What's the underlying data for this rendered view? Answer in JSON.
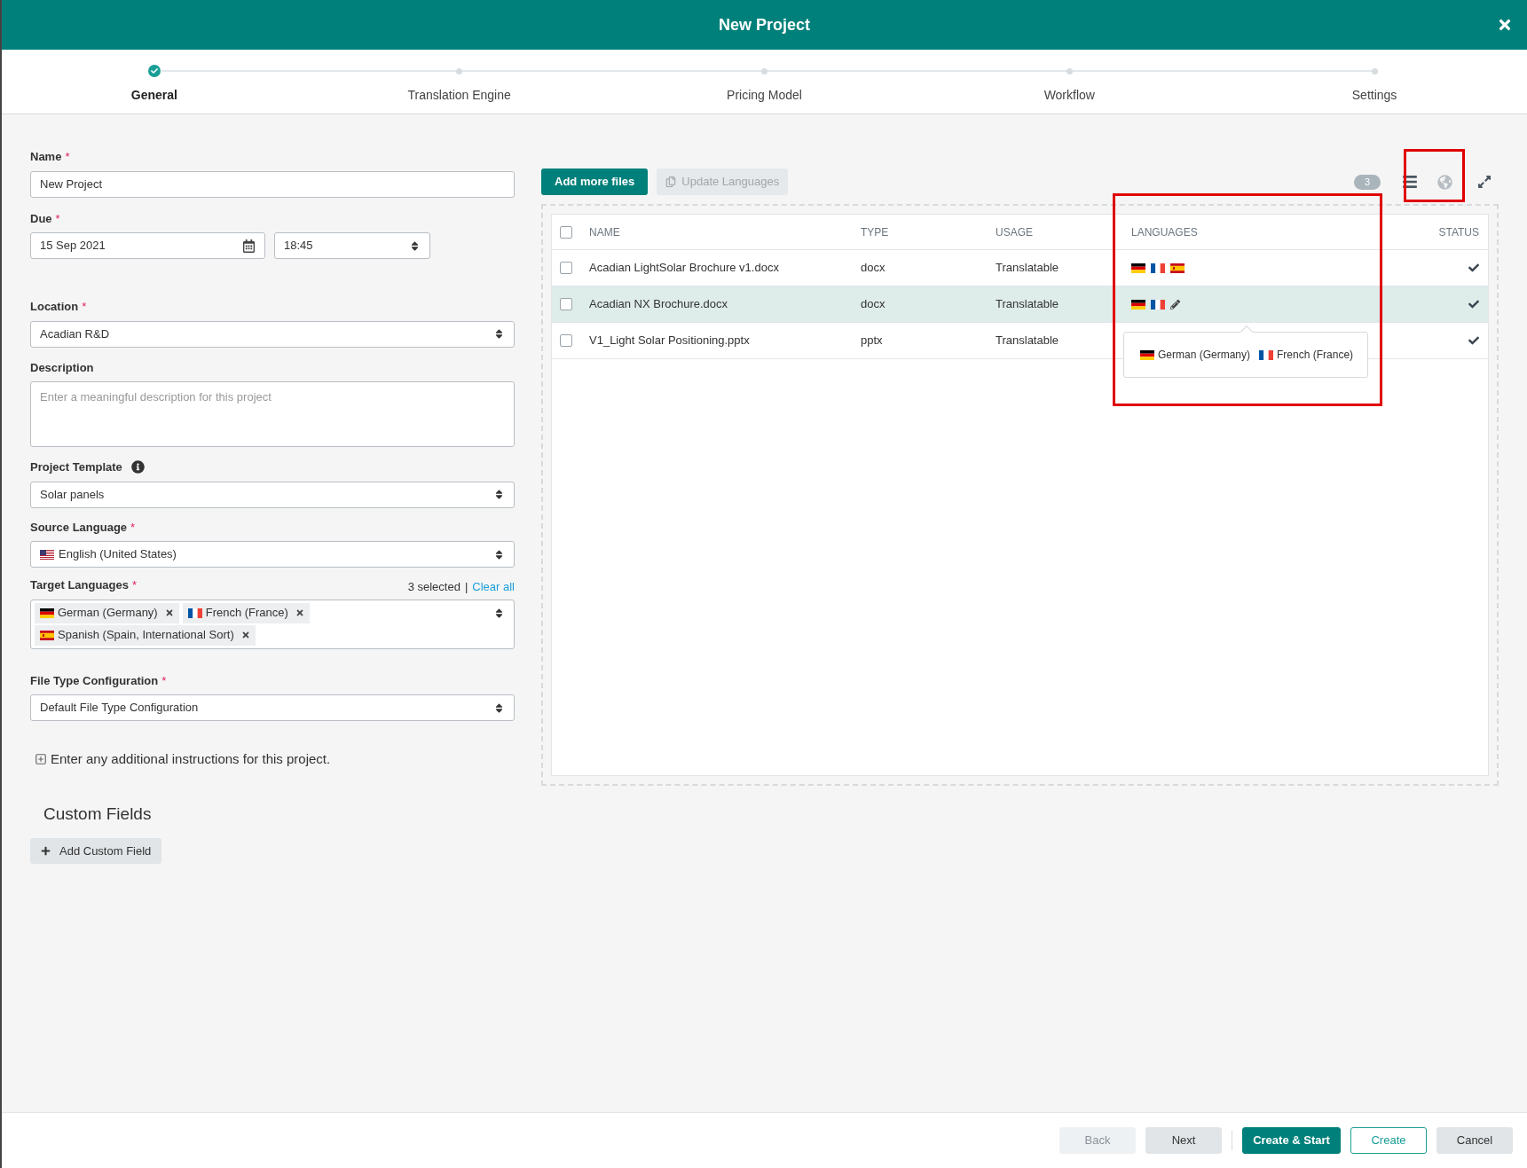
{
  "window": {
    "title": "New Project"
  },
  "steps": [
    {
      "label": "General",
      "selected": true
    },
    {
      "label": "Translation Engine",
      "selected": false
    },
    {
      "label": "Pricing Model",
      "selected": false
    },
    {
      "label": "Workflow",
      "selected": false
    },
    {
      "label": "Settings",
      "selected": false
    }
  ],
  "form": {
    "name": {
      "label": "Name",
      "marker": "*",
      "value": "New Project"
    },
    "due": {
      "label": "Due",
      "marker": "*",
      "date": "15 Sep 2021",
      "time": "18:45"
    },
    "location": {
      "label": "Location",
      "marker": "*",
      "value": "Acadian R&D"
    },
    "description": {
      "label": "Description",
      "placeholder": "Enter a meaningful description for this project"
    },
    "project_template": {
      "label": "Project Template",
      "value": "Solar panels"
    },
    "source_language": {
      "label": "Source Language",
      "marker": "*",
      "value": "English (United States)",
      "kind": "us"
    },
    "target_languages": {
      "label": "Target Languages",
      "marker": "*",
      "count": "3 selected",
      "separator": "|",
      "clear_link": "Clear all",
      "tags": [
        {
          "label": "German (Germany)",
          "kind": "de"
        },
        {
          "label": "French (France)",
          "kind": "fr"
        },
        {
          "label": "Spanish (Spain, International Sort)",
          "kind": "es"
        }
      ]
    },
    "file_type": {
      "label": "File Type Configuration",
      "marker": "*",
      "value": "Default File Type Configuration"
    },
    "instructions": "Enter any additional instructions for this project.",
    "custom_fields": {
      "title": "Custom Fields",
      "button": "Add Custom Field"
    }
  },
  "files": {
    "add_button": "Add more files",
    "update_button": {
      "label": "Update Languages",
      "disabled": true
    },
    "count": "3",
    "select_all": {
      "checked": false
    },
    "columns": [
      "NAME",
      "TYPE",
      "USAGE",
      "LANGUAGES",
      "STATUS"
    ],
    "rows": [
      {
        "name": "Acadian LightSolar Brochure v1.docx",
        "type": "docx",
        "usage": "Translatable",
        "languages": [
          {
            "kind": "de"
          },
          {
            "kind": "fr"
          },
          {
            "kind": "es"
          }
        ],
        "checked": false,
        "selected": false,
        "editing": false,
        "done": true
      },
      {
        "name": "Acadian NX Brochure.docx",
        "type": "docx",
        "usage": "Translatable",
        "languages": [
          {
            "kind": "de"
          },
          {
            "kind": "fr"
          }
        ],
        "checked": false,
        "selected": true,
        "editing": true,
        "done": true
      },
      {
        "name": "V1_Light Solar Positioning.pptx",
        "type": "pptx",
        "usage": "Translatable",
        "checked": false,
        "selected": false,
        "editing": false,
        "done": true
      }
    ],
    "popover": {
      "languages": [
        {
          "label": "German (Germany)",
          "kind": "de"
        },
        {
          "label": "French (France)",
          "kind": "fr"
        }
      ]
    }
  },
  "footer": {
    "buttons": [
      {
        "label": "Back",
        "kind": "secondary",
        "disabled": true
      },
      {
        "label": "Next",
        "kind": "secondary",
        "disabled": false
      },
      {
        "label": "Create & Start",
        "kind": "primary",
        "disabled": false
      },
      {
        "label": "Create",
        "kind": "outline",
        "disabled": false
      },
      {
        "label": "Cancel",
        "kind": "secondary",
        "disabled": false
      }
    ]
  }
}
